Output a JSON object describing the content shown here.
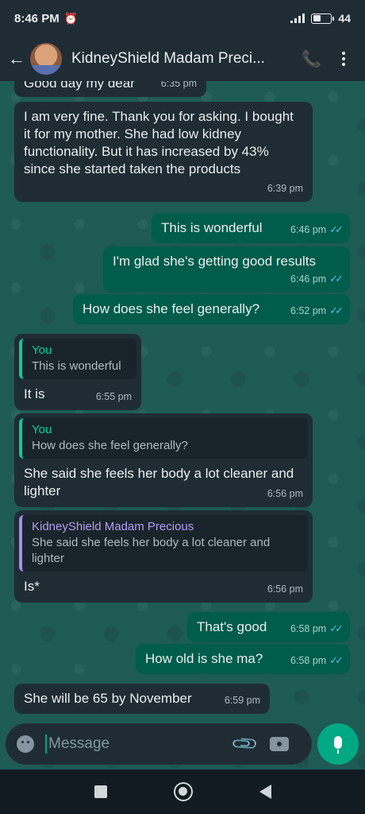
{
  "status_bar": {
    "time": "8:46 PM",
    "battery": "44",
    "battery_level": 0.44
  },
  "header": {
    "back_icon": "arrow-left-icon",
    "title": "KidneyShield Madam Preci...",
    "call_icon": "add-call-icon",
    "menu_icon": "more-vertical-icon"
  },
  "colors": {
    "incoming_bubble": "#1f2c34",
    "outgoing_bubble": "#005c4b",
    "accent": "#00a884",
    "read_ticks": "#53bdeb"
  },
  "messages": [
    {
      "direction": "in",
      "text": "Good day my dear",
      "time": "6:35 pm"
    },
    {
      "direction": "in",
      "text": "I am very fine. Thank you for asking. I bought it for my mother. She had low kidney functionality. But it has increased by 43% since she started taken the products",
      "time": "6:39 pm"
    },
    {
      "direction": "out",
      "text": "This is wonderful",
      "time": "6:46 pm"
    },
    {
      "direction": "out",
      "text": "I'm glad she's getting good results",
      "time": "6:46 pm"
    },
    {
      "direction": "out",
      "text": "How does she feel generally?",
      "time": "6:52 pm"
    },
    {
      "direction": "in",
      "quote_name": "You",
      "quote_text": "This is wonderful",
      "text": "It is",
      "time": "6:55 pm"
    },
    {
      "direction": "in",
      "quote_name": "You",
      "quote_text": "How does she feel generally?",
      "text": "She said she feels her body a lot cleaner and lighter",
      "time": "6:56 pm"
    },
    {
      "direction": "in",
      "quote_name": "KidneyShield Madam Precious",
      "quote_text": "She said she feels her body a lot cleaner and lighter",
      "text": "Is*",
      "time": "6:56 pm"
    },
    {
      "direction": "out",
      "text": "That's good",
      "time": "6:58 pm"
    },
    {
      "direction": "out",
      "text": "How old is she ma?",
      "time": "6:58 pm"
    },
    {
      "direction": "in",
      "text": "She will be 65 by November",
      "time": "6:59 pm"
    }
  ],
  "composer": {
    "placeholder": "Message"
  }
}
